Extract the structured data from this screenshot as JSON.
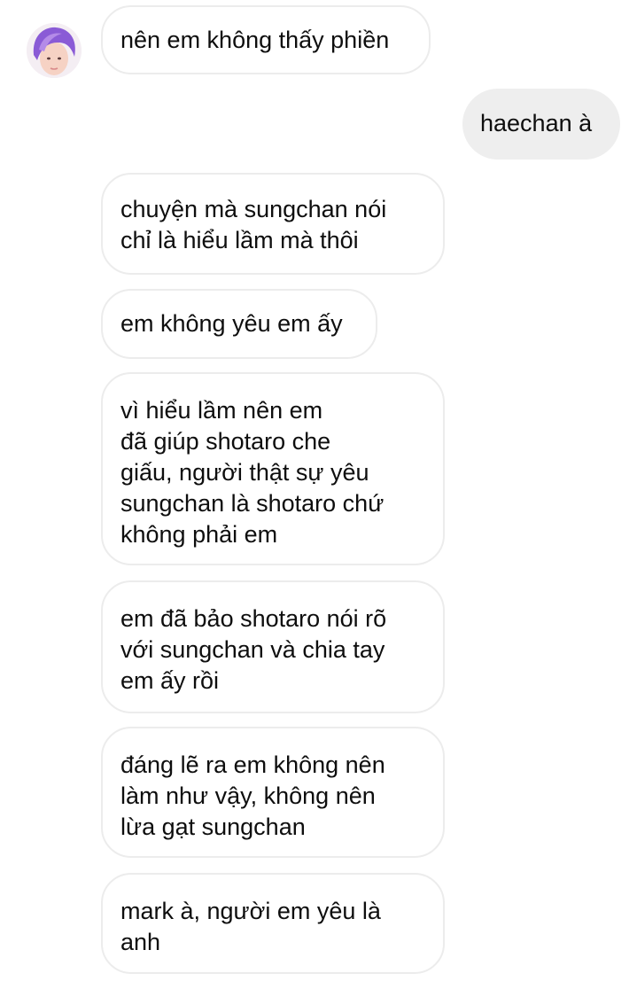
{
  "thread": {
    "messages": [
      {
        "sender": "other",
        "text": "nên em không thấy phiền"
      },
      {
        "sender": "me",
        "text": "haechan à"
      },
      {
        "sender": "other",
        "text": "chuyện mà sungchan nói\nchỉ là hiểu lầm mà thôi"
      },
      {
        "sender": "other",
        "text": "em không yêu em ấy"
      },
      {
        "sender": "other",
        "text": "vì hiểu lầm nên em\nđã giúp shotaro che\ngiấu, người thật sự yêu\nsungchan là shotaro chứ\nkhông phải em"
      },
      {
        "sender": "other",
        "text": "em đã bảo shotaro nói rõ\nvới sungchan và chia tay\nem ấy rồi"
      },
      {
        "sender": "other",
        "text": "đáng lẽ ra em không nên\nlàm như vậy, không nên\nlừa gạt sungchan"
      },
      {
        "sender": "other",
        "text": "mark à, người em yêu là\nanh"
      }
    ]
  },
  "colors": {
    "received_bubble_bg": "#ffffff",
    "received_bubble_border": "#ececec",
    "sent_bubble_bg": "#eeeeee",
    "text": "#0e0e0e",
    "avatar_hair": "#8a5bd6"
  },
  "icons": {
    "avatar": "contact-avatar-photo"
  }
}
